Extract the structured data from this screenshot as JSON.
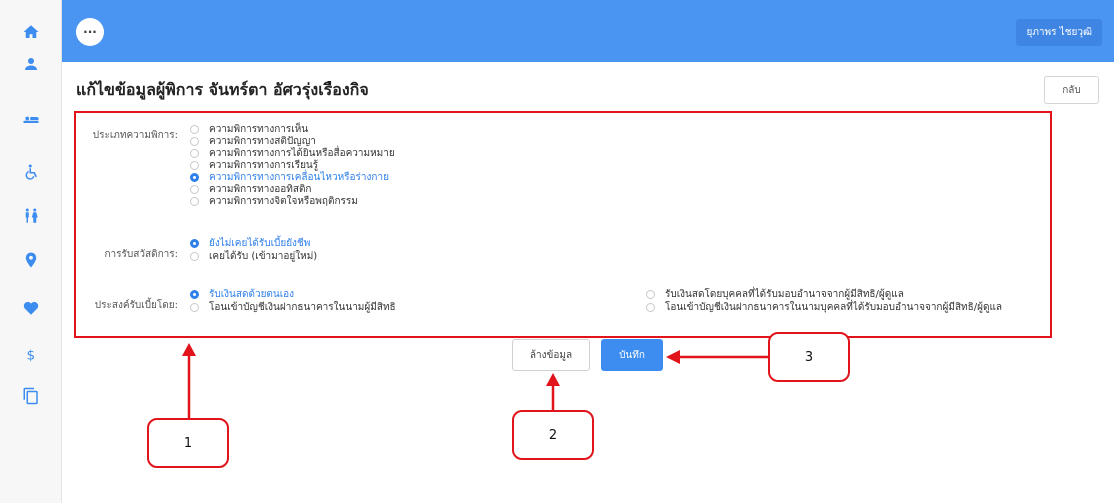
{
  "topbar": {
    "more_label": "···",
    "user_name": "ยุภาพร ไชยวุฒิ"
  },
  "page": {
    "title": "แก้ไขข้อมูลผู้พิการ จันทร์ตา อัศวรุ่งเรืองกิจ",
    "back_label": "กลับ"
  },
  "sidebar": {
    "icons": [
      "home-icon",
      "user-icon",
      "bed-icon",
      "wheelchair-icon",
      "family-icon",
      "location-icon",
      "heart-icon",
      "dollar-icon",
      "copy-icon"
    ]
  },
  "form": {
    "disability_type": {
      "label": "ประเภทความพิการ:",
      "options": [
        {
          "text": "ความพิการทางการเห็น",
          "selected": false
        },
        {
          "text": "ความพิการทางสติปัญญา",
          "selected": false
        },
        {
          "text": "ความพิการทางการได้ยินหรือสื่อความหมาย",
          "selected": false
        },
        {
          "text": "ความพิการทางการเรียนรู้",
          "selected": false
        },
        {
          "text": "ความพิการทางการเคลื่อนไหวหรือร่างกาย",
          "selected": true
        },
        {
          "text": "ความพิการทางออทิสติก",
          "selected": false
        },
        {
          "text": "ความพิการทางจิตใจหรือพฤติกรรม",
          "selected": false
        }
      ]
    },
    "welfare": {
      "label": "การรับสวัสดิการ:",
      "options": [
        {
          "text": "ยังไม่เคยได้รับเบี้ยยังชีพ",
          "selected": true
        },
        {
          "text": "เคยได้รับ (เข้ามาอยู่ใหม่)",
          "selected": false
        }
      ]
    },
    "payment": {
      "label": "ประสงค์รับเบี้ยโดย:",
      "options": [
        {
          "text": "รับเงินสดด้วยตนเอง",
          "selected": true
        },
        {
          "text": "โอนเข้าบัญชีเงินฝากธนาคารในนามผู้มีสิทธิ",
          "selected": false
        },
        {
          "text": "รับเงินสดโดยบุคคลที่ได้รับมอบอำนาจจากผู้มีสิทธิ/ผู้ดูแล",
          "selected": false
        },
        {
          "text": "โอนเข้าบัญชีเงินฝากธนาคารในนามบุคคลที่ได้รับมอบอำนาจจากผู้มีสิทธิ/ผู้ดูแล",
          "selected": false
        }
      ]
    }
  },
  "actions": {
    "clear_label": "ล้างข้อมูล",
    "save_label": "บันทึก"
  },
  "callouts": [
    "1",
    "2",
    "3"
  ],
  "colors": {
    "accent": "#3d8df0",
    "topbar": "#4a95f2",
    "annotation": "#e0141a"
  }
}
